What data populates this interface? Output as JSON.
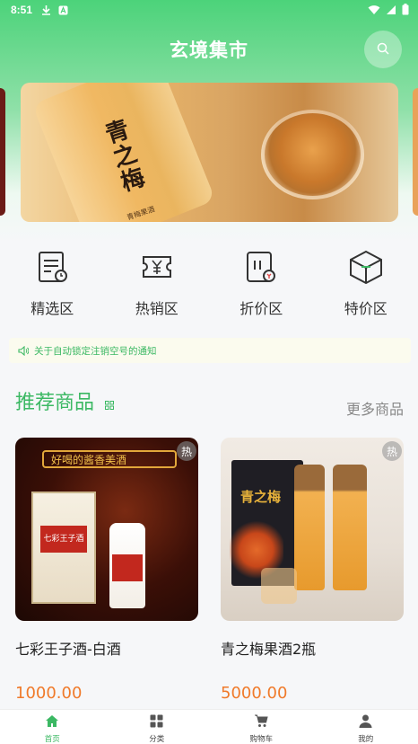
{
  "status_bar": {
    "time": "8:51"
  },
  "header": {
    "title": "玄境集市"
  },
  "banner": {
    "brand_text": "青之梅",
    "sub_text": "青梅果酒"
  },
  "categories": [
    {
      "label": "精选区",
      "icon": "document-clock-icon"
    },
    {
      "label": "热销区",
      "icon": "ticket-yen-icon"
    },
    {
      "label": "折价区",
      "icon": "discount-card-icon"
    },
    {
      "label": "特价区",
      "icon": "box-icon"
    }
  ],
  "notice": {
    "text": "关于自动锁定注销空号的通知"
  },
  "section": {
    "title": "推荐商品",
    "more_label": "更多商品"
  },
  "products": [
    {
      "name": "七彩王子酒-白酒",
      "price": "1000.00",
      "badge": "热",
      "banner_text": "好喝的酱香美酒",
      "box_label": "七彩王子酒"
    },
    {
      "name": "青之梅果酒2瓶",
      "price": "5000.00",
      "badge": "热",
      "bag_text": "青之梅"
    }
  ],
  "bottom_nav": [
    {
      "label": "首页",
      "active": true
    },
    {
      "label": "分类",
      "active": false
    },
    {
      "label": "购物车",
      "active": false
    },
    {
      "label": "我的",
      "active": false
    }
  ],
  "colors": {
    "accent": "#3bb863",
    "price": "#f07a2a",
    "header_green": "#4cd37a"
  }
}
